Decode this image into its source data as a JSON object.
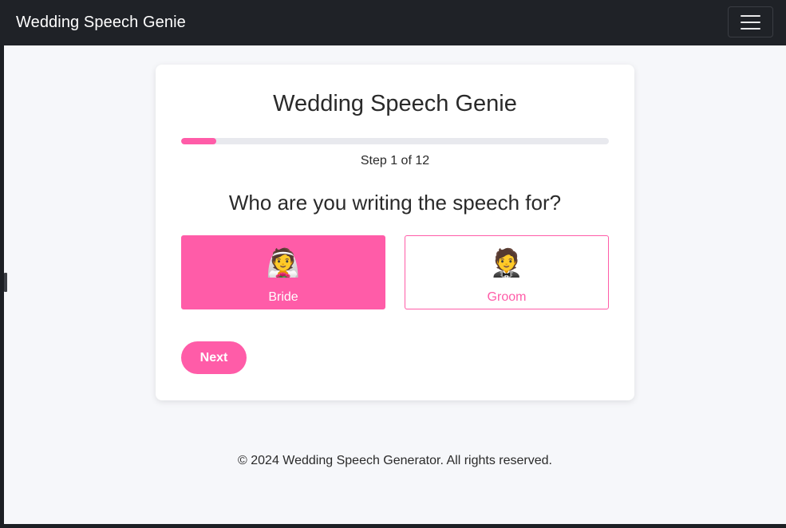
{
  "navbar": {
    "brand": "Wedding Speech Genie",
    "menu_icon": "hamburger-menu-icon"
  },
  "card": {
    "title": "Wedding Speech Genie",
    "progress": {
      "current": 1,
      "total": 12,
      "fraction": 0.083,
      "color": "#ff5ca8"
    },
    "step_text": "Step 1 of 12",
    "question": "Who are you writing the speech for?",
    "options": [
      {
        "emoji": "👰",
        "label": "Bride",
        "selected": true
      },
      {
        "emoji": "🤵",
        "label": "Groom",
        "selected": false
      }
    ],
    "next_label": "Next"
  },
  "footer": {
    "text": "© 2024 Wedding Speech Generator. All rights reserved."
  },
  "colors": {
    "accent": "#ff5ca8",
    "navbar": "#1f2227",
    "background": "#f6f7fa"
  }
}
